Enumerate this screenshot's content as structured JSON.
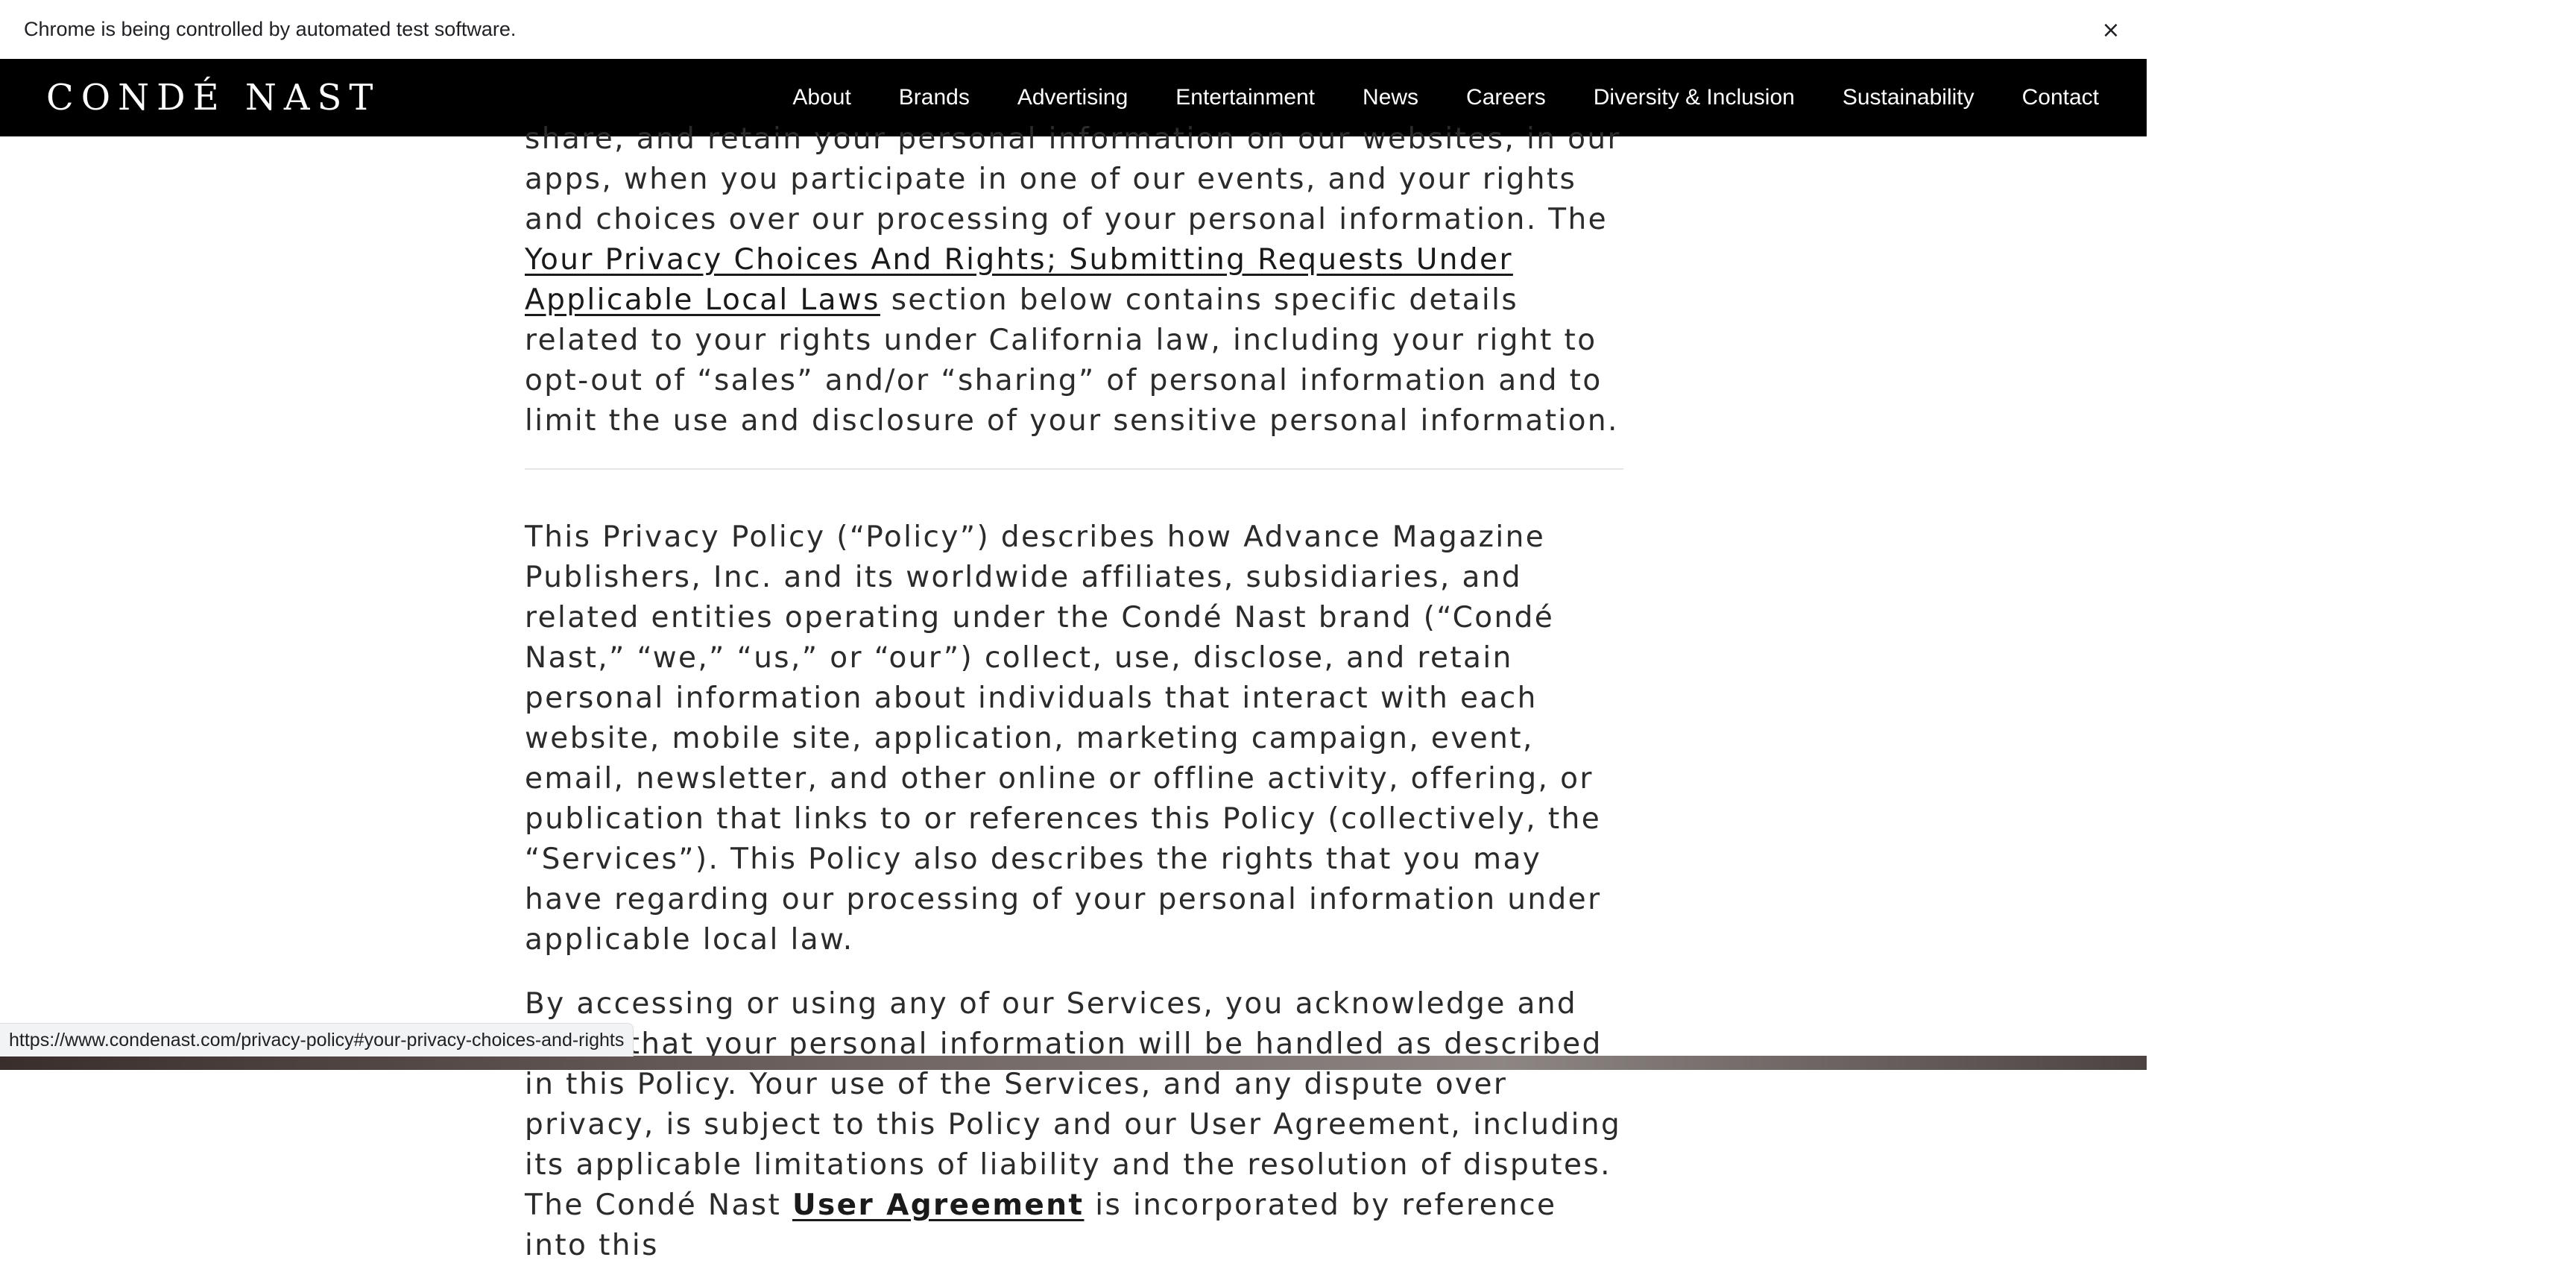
{
  "browser": {
    "infobar_text": "Chrome is being controlled by automated test software.",
    "close_glyph": "×",
    "status_url": "https://www.condenast.com/privacy-policy#your-privacy-choices-and-rights"
  },
  "nav": {
    "logo": "CONDÉ NAST",
    "links": [
      "About",
      "Brands",
      "Advertising",
      "Entertainment",
      "News",
      "Careers",
      "Diversity & Inclusion",
      "Sustainability",
      "Contact"
    ]
  },
  "article": {
    "intro_start": "share, and retain your personal information on our websites, in our apps, when you participate in one of our events, and your rights and choices over our processing of your personal information. The ",
    "intro_link": "Your Privacy Choices And Rights; Submitting Requests Under Applicable Local Laws",
    "intro_end": " section below contains specific details related to your rights under California law, including your right to opt-out of “sales” and/or “sharing” of personal information and to limit the use and disclosure of your sensitive personal information.",
    "para1": "This Privacy Policy (“Policy”) describes how Advance Magazine Publishers, Inc. and its worldwide affiliates, subsidiaries, and related entities operating under the Condé Nast brand (“Condé Nast,” “we,” “us,” or “our”) collect, use, disclose, and retain personal information about individuals that interact with each website, mobile site, application, marketing campaign, event, email, newsletter, and other online or offline activity, offering, or publication that links to or references this Policy (collectively, the “Services”). This Policy also describes the rights that you may have regarding our processing of your personal information under applicable local law.",
    "para2_start": "By accessing or using any of our Services, you acknowledge and agree that your personal information will be handled as described in this Policy. Your use of the Services, and any dispute over privacy, is subject to this Policy and our User Agreement, including its applicable limitations of liability and the resolution of disputes. The Condé Nast ",
    "para2_link": "User Agreement",
    "para2_end": " is incorporated by reference into this"
  }
}
